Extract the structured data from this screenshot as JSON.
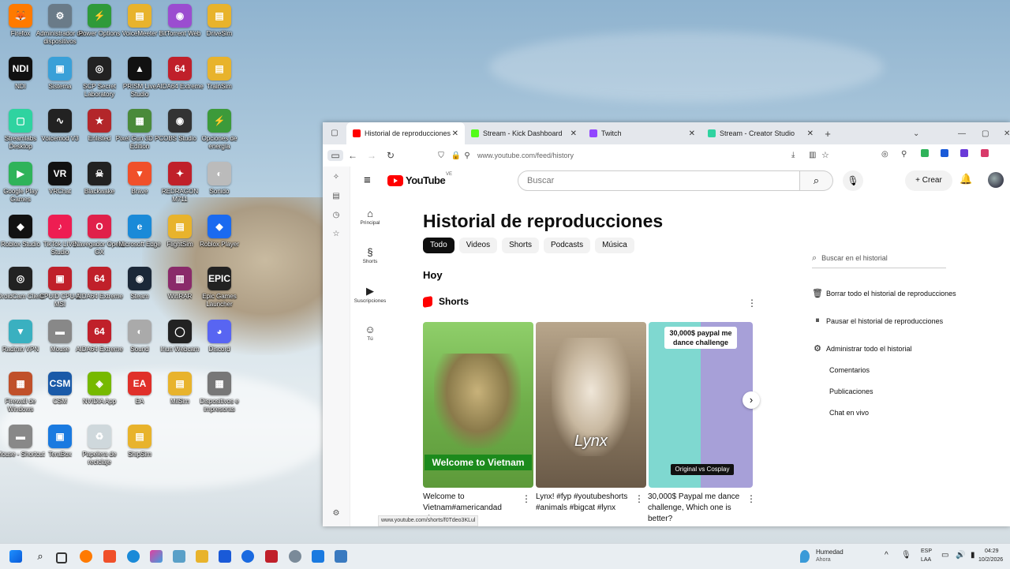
{
  "desktop": {
    "icons": [
      {
        "label": "Firefox",
        "color": "#ff7a00",
        "glyph": "🦊"
      },
      {
        "label": "Administrador de dispositivos",
        "color": "#6a7b88",
        "glyph": "⚙"
      },
      {
        "label": "Power Options",
        "color": "#2f9a3a",
        "glyph": "⚡"
      },
      {
        "label": "VoiceMeeter",
        "color": "#e8b32c",
        "glyph": "▤"
      },
      {
        "label": "BitTorrent Web",
        "color": "#9b4dd0",
        "glyph": "◉"
      },
      {
        "label": "DriveSim",
        "color": "#e8b32c",
        "glyph": "▤"
      },
      {
        "label": "NDI",
        "color": "#111111",
        "glyph": "NDI"
      },
      {
        "label": "Sistema",
        "color": "#3aa0d8",
        "glyph": "▣"
      },
      {
        "label": "SCP Secret Laboratory",
        "color": "#222222",
        "glyph": "◎"
      },
      {
        "label": "PRISM Live Studio",
        "color": "#111111",
        "glyph": "▲"
      },
      {
        "label": "AIDA64 Extreme",
        "color": "#c0202a",
        "glyph": "64"
      },
      {
        "label": "TrainSim",
        "color": "#e8b32c",
        "glyph": "▤"
      },
      {
        "label": "Streamlabs Desktop",
        "color": "#2fd3a0",
        "glyph": "▢"
      },
      {
        "label": "Voicemod V3",
        "color": "#222222",
        "glyph": "∿"
      },
      {
        "label": "Enlisted",
        "color": "#b3262a",
        "glyph": "★"
      },
      {
        "label": "Pixel Gun 3D PC Edition",
        "color": "#4a8a3a",
        "glyph": "▦"
      },
      {
        "label": "OBS Studio",
        "color": "#333333",
        "glyph": "◉"
      },
      {
        "label": "Opciones de energía",
        "color": "#3c9a3a",
        "glyph": "⚡"
      },
      {
        "label": "Google Play Games",
        "color": "#2fb35a",
        "glyph": "▶"
      },
      {
        "label": "VRChat",
        "color": "#111111",
        "glyph": "VR"
      },
      {
        "label": "Blackwake",
        "color": "#222222",
        "glyph": "☠"
      },
      {
        "label": "Brave",
        "color": "#f0502a",
        "glyph": "▼"
      },
      {
        "label": "REDRAGON M711",
        "color": "#c0202a",
        "glyph": "✦"
      },
      {
        "label": "Sonido",
        "color": "#bbbbbb",
        "glyph": "◐"
      },
      {
        "label": "Roblox Studio",
        "color": "#111111",
        "glyph": "◆"
      },
      {
        "label": "TikTok LIVE Studio",
        "color": "#ee1d52",
        "glyph": "♪"
      },
      {
        "label": "Navegador Opera GX",
        "color": "#e0204a",
        "glyph": "O"
      },
      {
        "label": "Microsoft Edge",
        "color": "#1a8ad8",
        "glyph": "e"
      },
      {
        "label": "FlightSim",
        "color": "#e8b32c",
        "glyph": "▤"
      },
      {
        "label": "Roblox Player",
        "color": "#1a6af0",
        "glyph": "◆"
      },
      {
        "label": "DroidCam Client",
        "color": "#222222",
        "glyph": "◎"
      },
      {
        "label": "CPUID CPU-Z MSI",
        "color": "#c0202a",
        "glyph": "▣"
      },
      {
        "label": "AIDA64 Extreme",
        "color": "#c0202a",
        "glyph": "64"
      },
      {
        "label": "Steam",
        "color": "#1b2838",
        "glyph": "◉"
      },
      {
        "label": "WinRAR",
        "color": "#8a2a6a",
        "glyph": "▥"
      },
      {
        "label": "Epic Games Launcher",
        "color": "#222222",
        "glyph": "EPIC"
      },
      {
        "label": "Radmin VPN",
        "color": "#3ab0c0",
        "glyph": "▼"
      },
      {
        "label": "Mouse",
        "color": "#888888",
        "glyph": "▬"
      },
      {
        "label": "AIDA64 Extreme",
        "color": "#c0202a",
        "glyph": "64"
      },
      {
        "label": "Sound",
        "color": "#aaaaaa",
        "glyph": "◐"
      },
      {
        "label": "Iriun Webcam",
        "color": "#222222",
        "glyph": "◯"
      },
      {
        "label": "Discord",
        "color": "#5865f2",
        "glyph": "◕"
      },
      {
        "label": "Firewall de Windows",
        "color": "#c0502a",
        "glyph": "▦"
      },
      {
        "label": "CSM",
        "color": "#1a5aa8",
        "glyph": "CSM"
      },
      {
        "label": "NVIDIA App",
        "color": "#76b900",
        "glyph": "◈"
      },
      {
        "label": "EA",
        "color": "#e0302a",
        "glyph": "EA"
      },
      {
        "label": "MilSim",
        "color": "#e8b32c",
        "glyph": "▤"
      },
      {
        "label": "Dispositivos e impresoras",
        "color": "#777777",
        "glyph": "▦"
      },
      {
        "label": "Mouse - Shortcut",
        "color": "#888888",
        "glyph": "▬"
      },
      {
        "label": "TeraBox",
        "color": "#1a7ae0",
        "glyph": "▣"
      },
      {
        "label": "Papelera de reciclaje",
        "color": "#cfd8dc",
        "glyph": "♻"
      },
      {
        "label": "ShipSim",
        "color": "#e8b32c",
        "glyph": "▤"
      }
    ]
  },
  "browser": {
    "tabs": [
      {
        "label": "Historial de reproducciones - Yo",
        "fav_color": "#ff0000",
        "active": true
      },
      {
        "label": "Stream - Kick Dashboard",
        "fav_color": "#53fc18",
        "active": false
      },
      {
        "label": "Twitch",
        "fav_color": "#9146ff",
        "active": false
      },
      {
        "label": "Stream - Creator Studio",
        "fav_color": "#2fd3a0",
        "active": false
      }
    ],
    "url": "www.youtube.com/feed/history",
    "status_url": "www.youtube.com/shorts/f0Tdeo3KLul"
  },
  "youtube": {
    "logo_text": "YouTube",
    "country": "VE",
    "search_placeholder": "Buscar",
    "create_label": "Crear",
    "left_nav": [
      {
        "label": "Principal",
        "icon": "home-icon",
        "glyph": "⌂"
      },
      {
        "label": "Shorts",
        "icon": "shorts-icon",
        "glyph": "§"
      },
      {
        "label": "Suscripciones",
        "icon": "subscriptions-icon",
        "glyph": "▶"
      },
      {
        "label": "Tú",
        "icon": "you-icon",
        "glyph": "☺"
      }
    ],
    "page_title": "Historial de reproducciones",
    "chips": [
      "Todo",
      "Videos",
      "Shorts",
      "Podcasts",
      "Música"
    ],
    "section_day": "Hoy",
    "shorts_header": "Shorts",
    "shorts": [
      {
        "title": "Welcome to Vietnam#americandad #funny",
        "caption": "Welcome to Vietnam"
      },
      {
        "title": "Lynx! #fyp #youtubeshorts #animals #bigcat #lynx",
        "caption": "Lynx"
      },
      {
        "title": "30,000$  Paypal me dance challenge,  Which one is better?",
        "caption_top": "30,000$ paypal me dance challenge",
        "caption_bottom": "Original vs Cosplay"
      }
    ],
    "right_panel": {
      "search_placeholder": "Buscar en el historial",
      "actions": [
        "Borrar todo el historial de reproducciones",
        "Pausar el historial de reproducciones",
        "Administrar todo el historial"
      ],
      "sub_items": [
        "Comentarios",
        "Publicaciones",
        "Chat en vivo"
      ]
    }
  },
  "taskbar": {
    "weather_label": "Humedad",
    "weather_sub": "Ahora",
    "lang_top": "ESP",
    "lang_bottom": "LAA",
    "time": "04:29",
    "date": "10/2/2026"
  }
}
